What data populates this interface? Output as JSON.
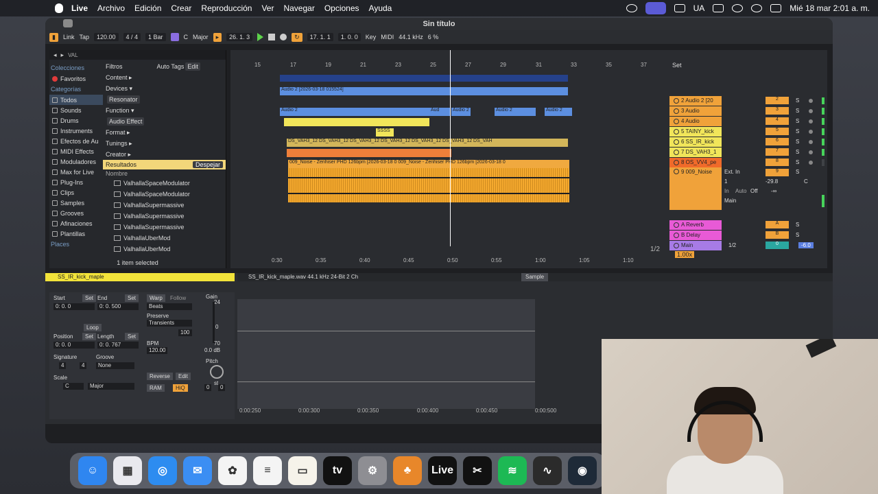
{
  "menubar": {
    "app": "Live",
    "items": [
      "Archivo",
      "Edición",
      "Crear",
      "Reproducción",
      "Ver",
      "Navegar",
      "Opciones",
      "Ayuda"
    ],
    "lang": "UA",
    "clock": "Mié 18 mar  2:01 a. m."
  },
  "window": {
    "title": "Sin título"
  },
  "control": {
    "link": "Link",
    "tap": "Tap",
    "tempo": "120.00",
    "signature": "4 / 4",
    "quant": "1 Bar",
    "key": "C",
    "scale": "Major",
    "position": "26.  1.  3",
    "loop_start": "17.  1.  1",
    "loop_len": "1.  0.  0",
    "key_label": "Key",
    "midi_label": "MIDI",
    "sample_rate": "44.1 kHz",
    "cpu": "6 %"
  },
  "browser": {
    "search": "VAL",
    "collections_header": "Colecciones",
    "favorites": "Favoritos",
    "categories_header": "Categorías",
    "categories": [
      "Todos",
      "Sounds",
      "Drums",
      "Instruments",
      "Efectos de Au",
      "MIDI Effects",
      "Moduladores",
      "Max for Live",
      "Plug-Ins",
      "Clips",
      "Samples",
      "Grooves",
      "Afinaciones",
      "Plantillas"
    ],
    "places_header": "Places",
    "filters_label": "Filtros",
    "autotags": "Auto Tags",
    "edit": "Edit",
    "filter_rows": [
      "Content ▸",
      "Devices ▾",
      "Function ▾",
      "Format ▸",
      "Tunings ▸",
      "Creator ▸"
    ],
    "tags": [
      "Resonator",
      "Audio Effect"
    ],
    "results_label": "Resultados",
    "clear_label": "Despejar",
    "name_header": "Nombre",
    "results": [
      "ValhallaSpaceModulator",
      "ValhallaSpaceModulator",
      "ValhallaSupermassive",
      "ValhallaSupermassive",
      "ValhallaSupermassive",
      "ValhallaUberMod",
      "ValhallaUberMod"
    ],
    "footer": "1 item selected"
  },
  "arrangement": {
    "bars": [
      "15",
      "17",
      "19",
      "21",
      "23",
      "25",
      "27",
      "29",
      "31",
      "33",
      "35",
      "37"
    ],
    "times": [
      "0:30",
      "0:35",
      "0:40",
      "0:45",
      "0:50",
      "0:55",
      "1:00",
      "1:05",
      "1:10"
    ],
    "set_label": "Set",
    "clips": {
      "audio2_top": "Audio 2 [2026-03-18 015524]",
      "audio2_row": "Audio 2",
      "audio2_tail": [
        "Aud",
        "A",
        "Audio 2",
        "A",
        "Au",
        "Audio",
        "Audio 2",
        "Audio 2",
        "Aud"
      ],
      "ss_label": "SSSS",
      "vah_label": "DS_VAH3_12 DS_VAH3_12 DS_VAH3_12 DS_VAH3_12 DS_VAH3_12 DS_VAH3_12 DS_VAH",
      "noise_label": "009_Noise - Zenhiser PHD 126bpm [2026-03-18 0 009_Noise - Zenhiser PHD 126bpm [2026-03-18 0"
    },
    "page": "1/2"
  },
  "tracks": [
    {
      "name": "2 Audio 2 [20",
      "num": "2",
      "color": "#f0a23a"
    },
    {
      "name": "3 Audio",
      "num": "3",
      "color": "#f0a23a"
    },
    {
      "name": "4 Audio",
      "num": "4",
      "color": "#f0a23a"
    },
    {
      "name": "5 TAINY_kick",
      "num": "5",
      "color": "#f1e55a"
    },
    {
      "name": "6 SS_IR_kick",
      "num": "6",
      "color": "#f1e55a"
    },
    {
      "name": "7 DS_VAH3_1",
      "num": "7",
      "color": "#f1e55a"
    },
    {
      "name": "8 OS_VV4_pe",
      "num": "8",
      "color": "#f06a2a"
    },
    {
      "name": "9 009_Noise",
      "num": "9",
      "color": "#f0a23a"
    },
    {
      "name": "A Reverb",
      "num": "A",
      "color": "#e85ad6"
    },
    {
      "name": "B Delay",
      "num": "B",
      "color": "#e85ad6"
    },
    {
      "name": "Main",
      "num": "0",
      "color": "#a77be6"
    }
  ],
  "io": {
    "ext_in": "Ext. In",
    "ch": "1",
    "gain": "-29.8",
    "pan": "C",
    "inf": "-∞",
    "in": "In",
    "auto": "Auto",
    "off": "Off",
    "main": "Main",
    "half": "1/2",
    "main_vol": "-6.0",
    "zoom": "1.00x"
  },
  "clipdetail": {
    "name": "SS_IR_kick_maple",
    "file": "SS_IR_kick_maple.wav 44.1 kHz  24-Bit  2 Ch",
    "sample_tab": "Sample",
    "start": "Start",
    "end": "End",
    "set": "Set",
    "start_val": "0:  0.  0",
    "end_val": "0:  0.  500",
    "loop": "Loop",
    "position": "Position",
    "length": "Length",
    "pos_val": "0:  0.  0",
    "len_val": "0:  0.  767",
    "signature": "Signature",
    "sig_num": "4",
    "sig_den": "4",
    "groove": "Groove",
    "groove_val": "None",
    "scale": "Scale",
    "scale_key": "C",
    "scale_mode": "Major",
    "warp": "Warp",
    "follow": "Follow",
    "warp_mode": "Beats",
    "preserve": "Preserve",
    "transients": "Transients",
    "ratio": "100",
    "bpm_label": "BPM",
    "bpm": "120.00",
    "reverse": "Reverse",
    "edit": "Edit",
    "ram": "RAM",
    "hiq": "HiQ",
    "gain": "Gain",
    "gain_top": "24",
    "gain_zero": "0",
    "gain_70": "70",
    "gain_val": "0.0 dB",
    "pitch": "Pitch",
    "pitch_st": "st",
    "pitch_a": "0",
    "pitch_b": "0",
    "times": [
      "0:00:250",
      "0:00:300",
      "0:00:350",
      "0:00:400",
      "0:00:450",
      "0:00:500"
    ]
  },
  "dock": [
    {
      "name": "finder",
      "label": "☺",
      "color": "#2f86f0"
    },
    {
      "name": "launchpad",
      "label": "▦",
      "color": "#e9e9ee"
    },
    {
      "name": "safari",
      "label": "◎",
      "color": "#2d8cf0"
    },
    {
      "name": "mail",
      "label": "✉",
      "color": "#3b8ef3"
    },
    {
      "name": "photos",
      "label": "✿",
      "color": "#f4f4f4"
    },
    {
      "name": "reminders",
      "label": "≡",
      "color": "#f4f4f4"
    },
    {
      "name": "notes",
      "label": "▭",
      "color": "#f6f3ea"
    },
    {
      "name": "tv",
      "label": "tv",
      "color": "#111"
    },
    {
      "name": "settings",
      "label": "⚙",
      "color": "#8e8e93"
    },
    {
      "name": "flstudio",
      "label": "♣",
      "color": "#e8872a"
    },
    {
      "name": "live",
      "label": "Live",
      "color": "#111"
    },
    {
      "name": "capcut",
      "label": "✂",
      "color": "#111"
    },
    {
      "name": "spotify",
      "label": "≋",
      "color": "#1db954"
    },
    {
      "name": "audio",
      "label": "∿",
      "color": "#2b2b2b"
    },
    {
      "name": "obs",
      "label": "◉",
      "color": "#1e2a38"
    }
  ]
}
